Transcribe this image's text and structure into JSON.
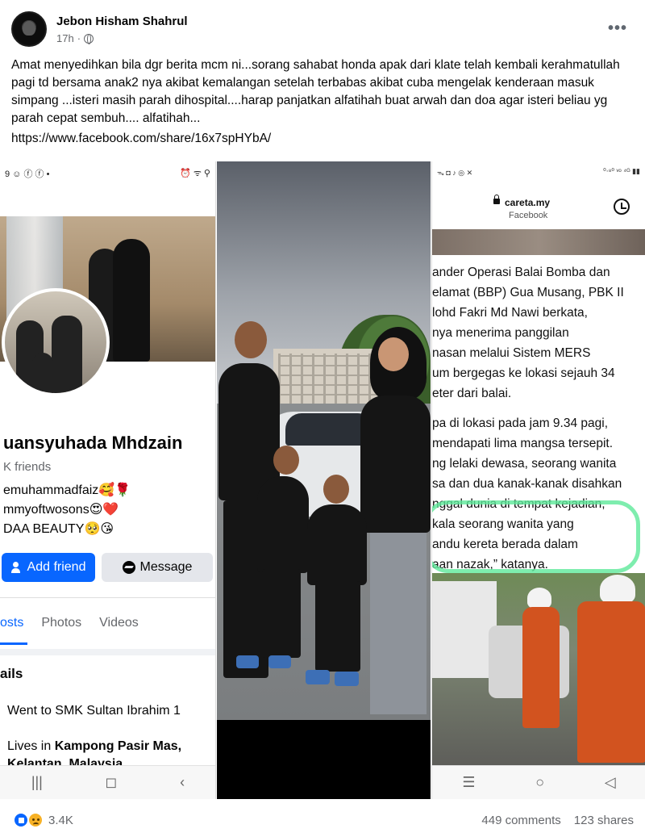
{
  "post": {
    "author": "Jebon Hisham Shahrul",
    "time": "17h",
    "more": "•••",
    "text": "Amat menyedihkan bila dgr berita mcm ni...sorang sahabat honda apak dari klate telah kembali kerahmatullah pagi td bersama anak2 nya akibat kemalangan setelah terbabas akibat cuba mengelak kenderaan masuk simpang ...isteri masih parah dihospital....harap panjatkan alfatihah buat arwah dan doa agar isteri beliau yg parah cepat sembuh.... alfatihah...",
    "link": "https://www.facebook.com/share/16x7spHYbA/"
  },
  "panel_left": {
    "status_left": "9 ☺ ⓕ ⓕ •",
    "status_right": "⏰ ᯤ ⚲",
    "profile_name": "uansyuhada Mhdzain",
    "friends": "K friends",
    "bio_lines": [
      "emuhammadfaiz🥰🌹",
      "mmyoftwosons😍❤️",
      "DAA BEAUTY🥺😘"
    ],
    "add_friend": "Add friend",
    "message": "Message",
    "tabs": [
      "osts",
      "Photos",
      "Videos"
    ],
    "details_title": "ails",
    "details": [
      {
        "prefix": "Went to SMK Sultan Ibrahim 1",
        "bold": ""
      },
      {
        "prefix": "Lives in ",
        "bold": "Kampong Pasir Mas,"
      },
      {
        "prefix": "",
        "bold": "Kelantan, Malaysia"
      }
    ],
    "nav": [
      "|||",
      "◻",
      "‹"
    ]
  },
  "panel_right": {
    "status_left": "ᯓ ◘ ♪ ◎ ✕",
    "status_right": "⁰⋅⁸⁰ ᵛᵒ ⁴ᴳ ▮▮",
    "url": "careta.my",
    "url_sub": "Facebook",
    "article_lines": [
      "ander Operasi Balai Bomba dan",
      "elamat (BBP) Gua Musang, PBK II",
      "lohd Fakri Md Nawi berkata,",
      "nya menerima panggilan",
      "nasan melalui Sistem MERS",
      "um bergegas ke lokasi sejauh 34",
      "eter dari balai.",
      "",
      "pa di lokasi pada jam 9.34 pagi,",
      "mendapati lima mangsa tersepit.",
      "ng lelaki dewasa, seorang wanita",
      "sa dan dua kanak-kanak disahkan",
      "nggal dunia di tempat kejadian,",
      "kala seorang wanita yang",
      "andu kereta berada dalam",
      "aan nazak,” katanya."
    ],
    "nav": [
      "☰",
      "○",
      "◁"
    ]
  },
  "footer": {
    "reaction_count": "3.4K",
    "comments": "449 comments",
    "shares": "123 shares"
  }
}
